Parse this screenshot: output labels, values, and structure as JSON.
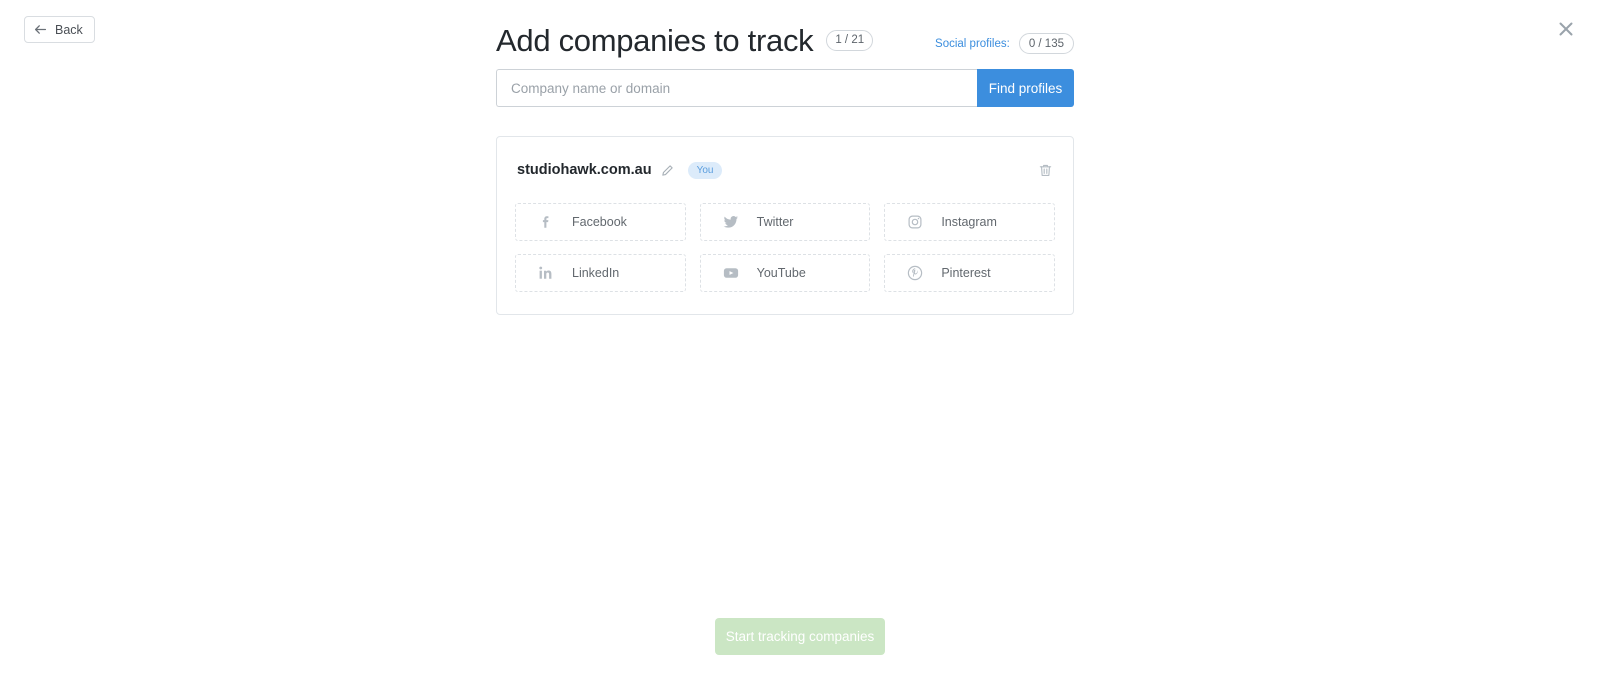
{
  "nav": {
    "back_label": "Back",
    "close_icon": "close-x-icon"
  },
  "header": {
    "title": "Add companies to track",
    "company_count": "1 / 21",
    "social_profiles_label": "Social profiles:",
    "social_profiles_count": "0 / 135"
  },
  "search": {
    "placeholder": "Company name or domain",
    "value": "",
    "button_label": "Find profiles"
  },
  "company": {
    "domain": "studiohawk.com.au",
    "badge": "You",
    "edit_icon": "pencil-icon",
    "delete_icon": "trash-icon",
    "social_networks": [
      {
        "label": "Facebook",
        "icon": "facebook-icon"
      },
      {
        "label": "Twitter",
        "icon": "twitter-icon"
      },
      {
        "label": "Instagram",
        "icon": "instagram-icon"
      },
      {
        "label": "LinkedIn",
        "icon": "linkedin-icon"
      },
      {
        "label": "YouTube",
        "icon": "youtube-icon"
      },
      {
        "label": "Pinterest",
        "icon": "pinterest-icon"
      }
    ]
  },
  "footer": {
    "cta_label": "Start tracking companies",
    "cta_disabled": true
  },
  "colors": {
    "accent_blue": "#3c8ede",
    "badge_bg": "#dcebfa",
    "badge_text": "#5b9ede",
    "cta_disabled_green": "#cbe6c4",
    "border_grey": "#e2e6ea",
    "icon_grey": "#b6bdc4"
  }
}
